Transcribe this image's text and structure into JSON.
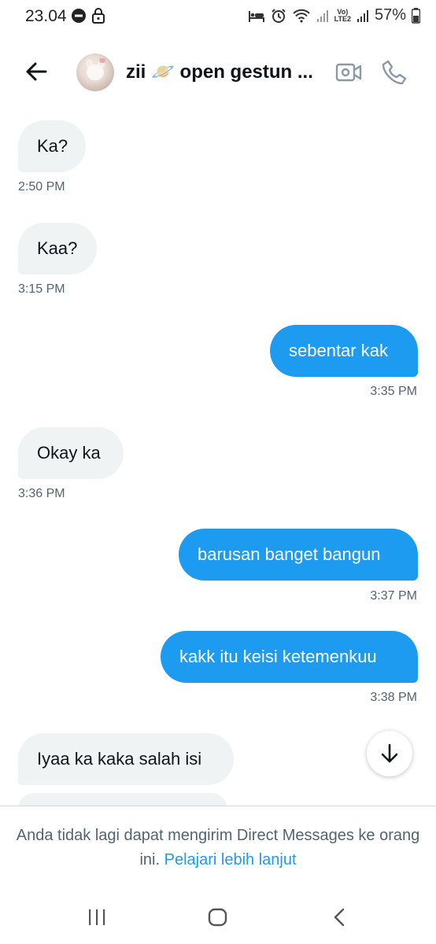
{
  "status_bar": {
    "time": "23.04",
    "lte_label": "Vo)\nLTE2",
    "battery": "57%"
  },
  "header": {
    "title": "zii 🪐 open gestun ..."
  },
  "messages": [
    {
      "text": "Ka?",
      "time": "2:50 PM",
      "direction": "in"
    },
    {
      "text": "Kaa?",
      "time": "3:15 PM",
      "direction": "in"
    },
    {
      "text": "sebentar kak",
      "time": "3:35 PM",
      "direction": "out"
    },
    {
      "text": "Okay ka",
      "time": "3:36 PM",
      "direction": "in"
    },
    {
      "text": "barusan banget bangun",
      "time": "3:37 PM",
      "direction": "out"
    },
    {
      "text": "kakk itu keisi ketemenkuu",
      "time": "3:38 PM",
      "direction": "out"
    },
    {
      "text": "Iyaa ka kaka salah isi",
      "time": "",
      "direction": "in"
    }
  ],
  "notice": {
    "text": "Anda tidak lagi dapat mengirim Direct Messages ke orang ini.",
    "link": "Pelajari lebih lanjut"
  },
  "colors": {
    "accent": "#1d9bf0",
    "incoming_bubble": "#eff3f4",
    "muted_text": "#536471"
  },
  "icons": {
    "back": "arrow-left-icon",
    "video": "video-camera-icon",
    "phone": "phone-icon",
    "scroll": "arrow-down-icon",
    "nav_recents": "recents-icon",
    "nav_home": "home-icon",
    "nav_back": "chevron-left-icon"
  }
}
